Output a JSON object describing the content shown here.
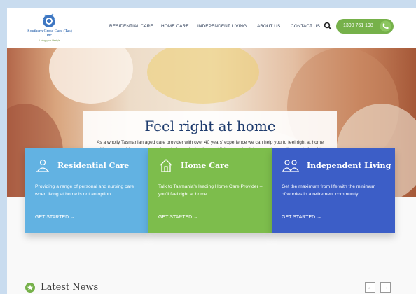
{
  "brand": {
    "name": "Southern Cross Care (Tas) Inc.",
    "tagline": "Living your lifestyle"
  },
  "nav": {
    "items": [
      "RESIDENTIAL CARE",
      "HOME CARE",
      "INDEPENDENT LIVING",
      "ABOUT US",
      "CONTACT US"
    ],
    "phone": "1300 761 198"
  },
  "hero": {
    "title": "Feel right at home",
    "description": "As a wholly Tasmanian aged care provider with over 40 years' experience we can help you to feel right at home with a range of home care services, independent retirement living, residential or respite care that are tailored to meet your needs."
  },
  "cards": [
    {
      "title": "Residential Care",
      "description": "Providing a range of personal and nursing care when living at home is not an option",
      "cta": "GET STARTED →",
      "color": "#62b2e2",
      "icon": "people-icon"
    },
    {
      "title": "Home Care",
      "description": "Talk to Tasmania's leading Home Care Provider – you'll feel right at home",
      "cta": "GET STARTED →",
      "color": "#7dbd4c",
      "icon": "house-icon"
    },
    {
      "title": "Independent Living",
      "description": "Get the maximum from life with the minimum of worries in a retirement community",
      "cta": "GET STARTED →",
      "color": "#3c5ec7",
      "icon": "couple-icon"
    }
  ],
  "news": {
    "title": "Latest News",
    "prev": "←",
    "next": "→"
  },
  "colors": {
    "accent_green": "#76b14a",
    "navy": "#1f3c6e"
  }
}
